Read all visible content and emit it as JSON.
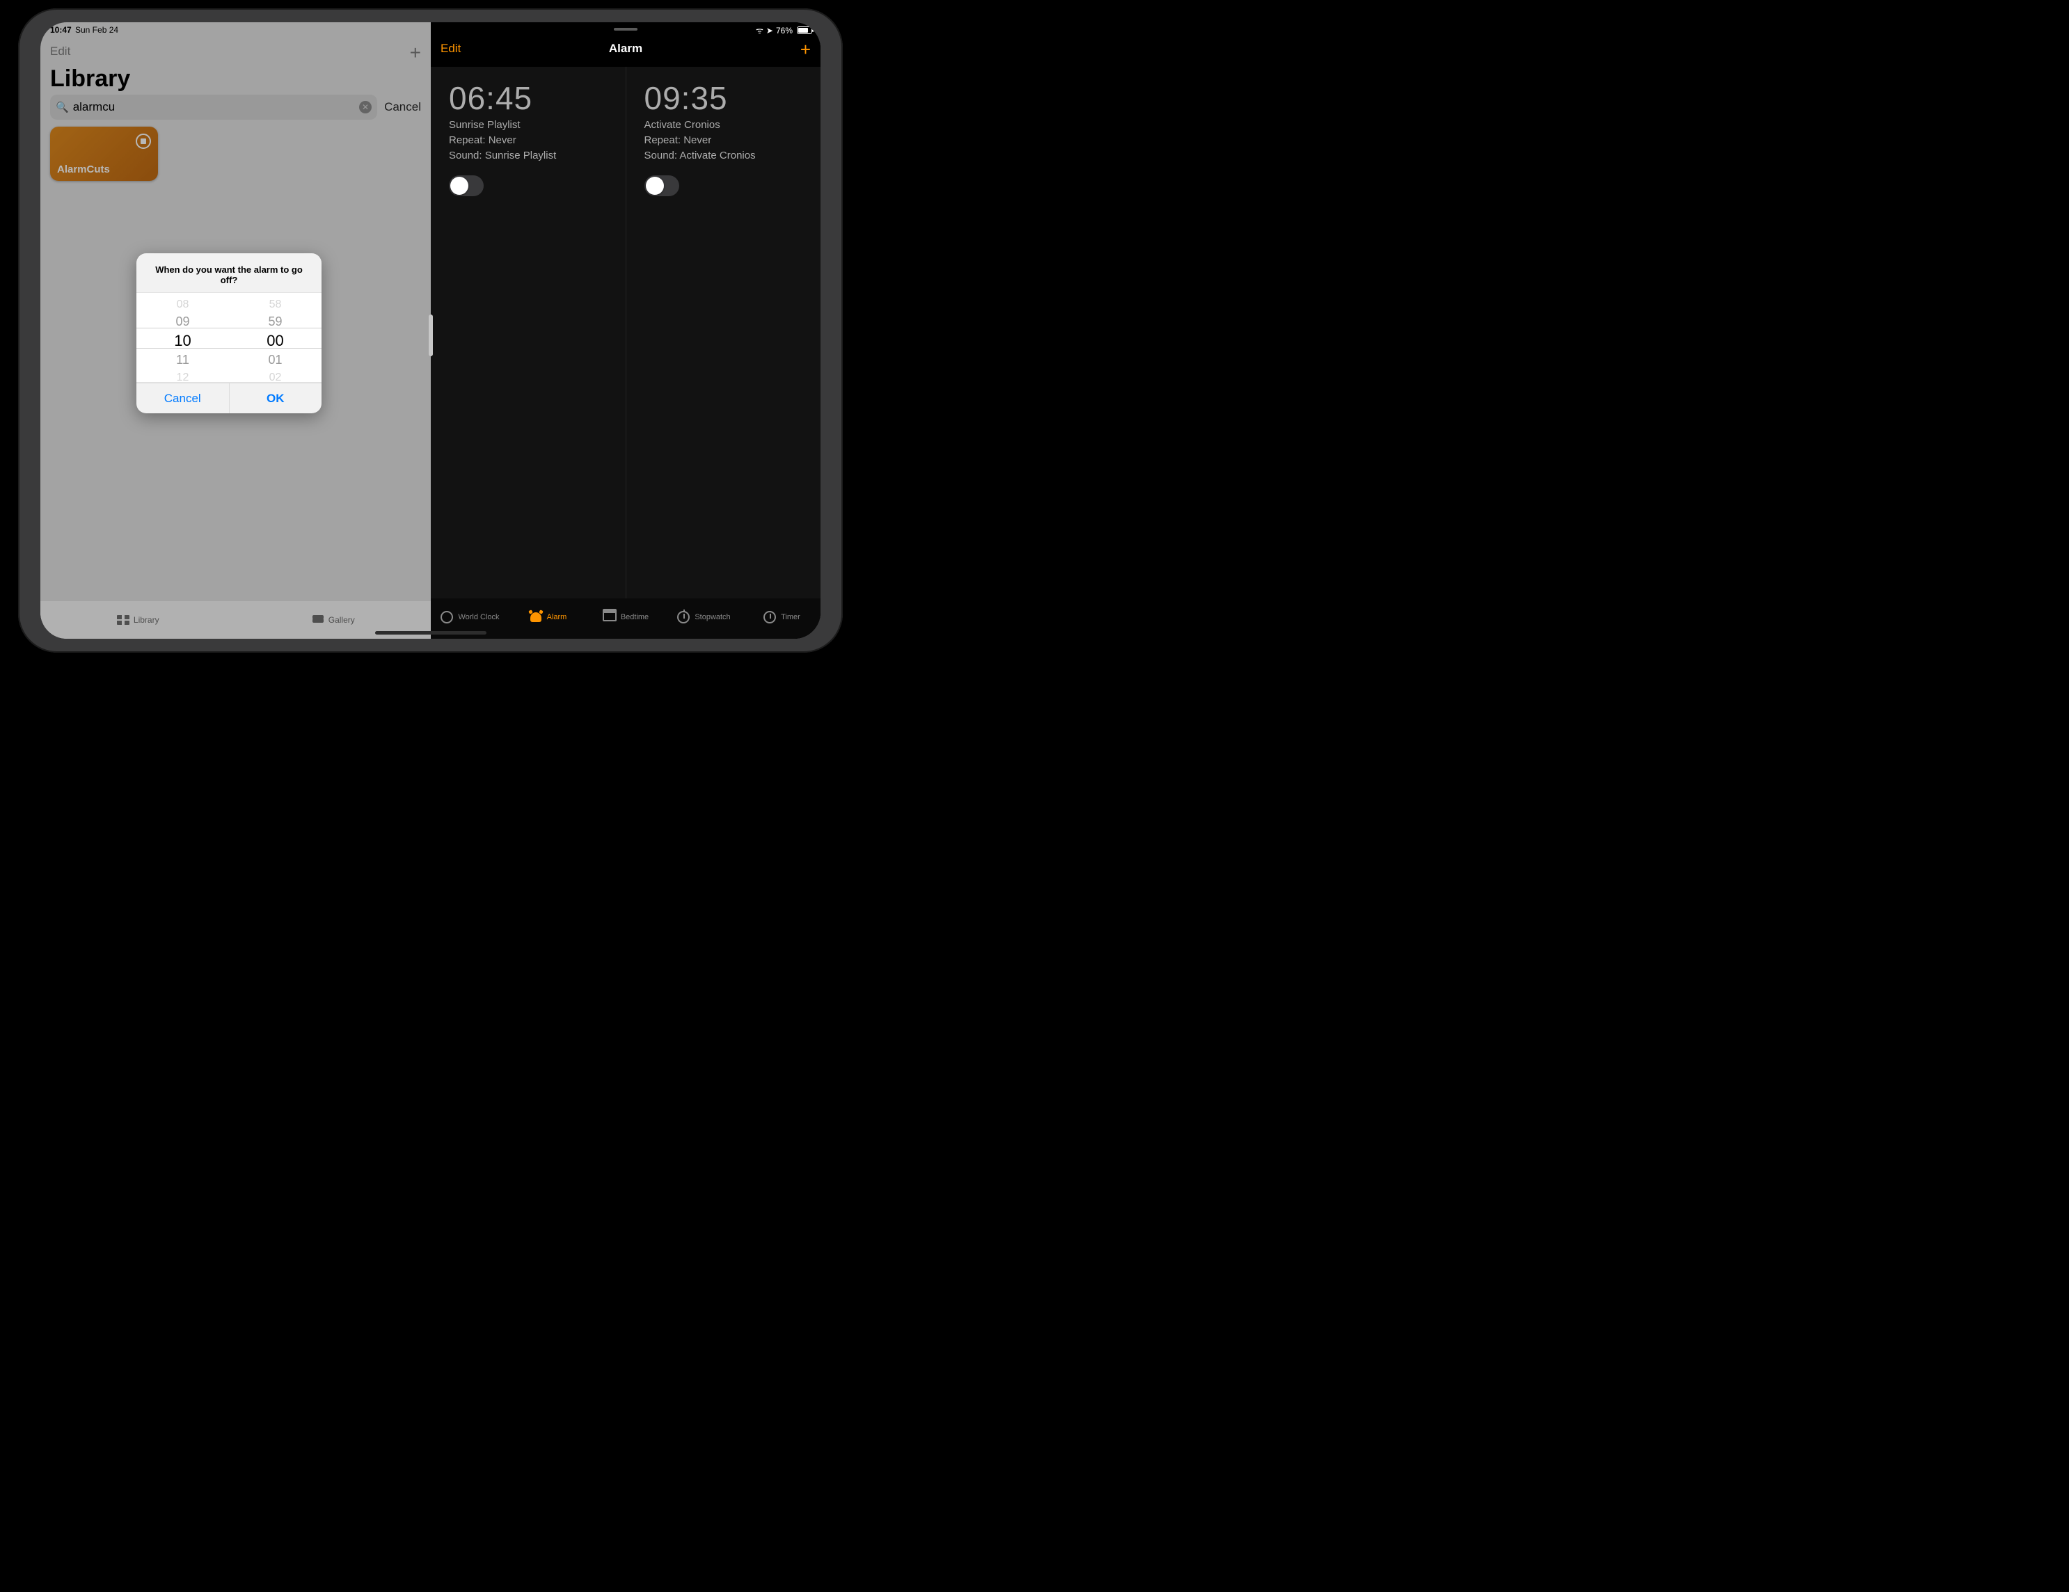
{
  "status": {
    "time": "10:47",
    "date": "Sun Feb 24",
    "battery": "76%"
  },
  "shortcuts": {
    "edit": "Edit",
    "title": "Library",
    "search_value": "alarmcu",
    "cancel": "Cancel",
    "card_name": "AlarmCuts",
    "tab_library": "Library",
    "tab_gallery": "Gallery"
  },
  "dialog": {
    "prompt": "When do you want the alarm to go off?",
    "hours": {
      "m2": "08",
      "m1": "09",
      "sel": "10",
      "p1": "11",
      "p2": "12"
    },
    "minutes": {
      "m2": "58",
      "m1": "59",
      "sel": "00",
      "p1": "01",
      "p2": "02"
    },
    "cancel": "Cancel",
    "ok": "OK"
  },
  "clock": {
    "edit": "Edit",
    "title": "Alarm",
    "alarms": [
      {
        "time": "06:45",
        "name": "Sunrise Playlist",
        "repeat": "Repeat: Never",
        "sound": "Sound: Sunrise Playlist"
      },
      {
        "time": "09:35",
        "name": "Activate Cronios",
        "repeat": "Repeat: Never",
        "sound": "Sound: Activate Cronios"
      }
    ],
    "tabs": {
      "world": "World Clock",
      "alarm": "Alarm",
      "bed": "Bedtime",
      "stop": "Stopwatch",
      "timer": "Timer"
    }
  }
}
